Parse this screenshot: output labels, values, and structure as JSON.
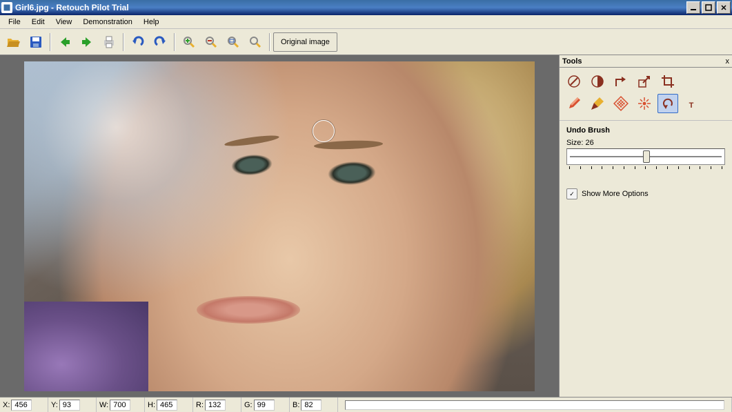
{
  "title": "Girl6.jpg - Retouch Pilot Trial",
  "menu": {
    "items": [
      "File",
      "Edit",
      "View",
      "Demonstration",
      "Help"
    ]
  },
  "toolbar": {
    "open": "Open",
    "save": "Save",
    "undo_arrow_l": "Back",
    "undo_arrow_r": "Forward",
    "print": "Print",
    "undo": "Undo",
    "redo": "Redo",
    "zoom_in": "Zoom In",
    "zoom_out": "Zoom Out",
    "zoom_fit": "Fit",
    "zoom_100": "100%",
    "original": "Original image"
  },
  "tools": {
    "title": "Tools",
    "close": "x",
    "row1": [
      "retouch-tool",
      "contrast-tool",
      "rotate-tool",
      "scale-tool",
      "crop-tool"
    ],
    "row2": [
      "pencil-tool",
      "brush-tool",
      "patch-tool",
      "burst-tool",
      "undo-brush-tool",
      "text-tool"
    ],
    "selected_name": "Undo Brush",
    "size_label": "Size:",
    "size_value": "26",
    "slider_percent": 48,
    "show_more": "Show More Options"
  },
  "status": {
    "x_label": "X:",
    "x": "456",
    "y_label": "Y:",
    "y": "93",
    "w_label": "W:",
    "w": "700",
    "h_label": "H:",
    "h": "465",
    "r_label": "R:",
    "r": "132",
    "g_label": "G:",
    "g": "99",
    "b_label": "B:",
    "b": "82"
  }
}
